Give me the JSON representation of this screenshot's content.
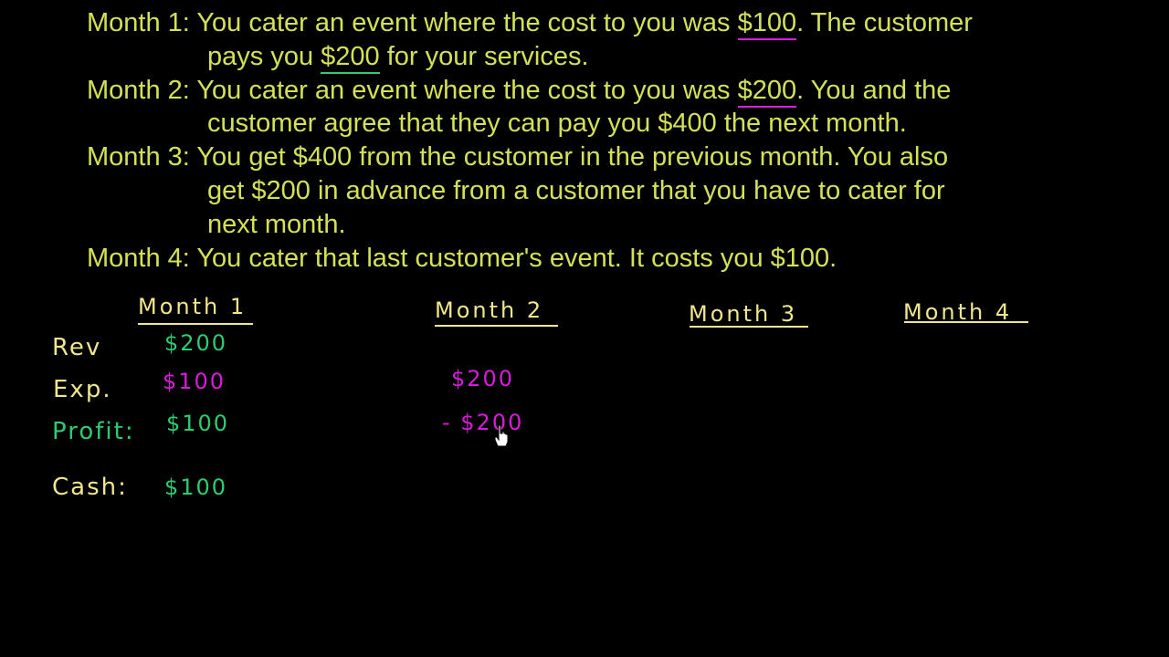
{
  "problem": {
    "month1": {
      "lead": "Month 1: You cater an event where the cost to you was ",
      "cost": "$100",
      "mid": ".  The customer",
      "line2_lead": "pays you ",
      "paid": "$200",
      "line2_tail": " for your services."
    },
    "month2": {
      "lead": "Month 2: You cater an event where the cost to you was ",
      "cost": "$200",
      "mid": ".  You and the",
      "line2": "customer agree that they can pay you $400 the next month."
    },
    "month3": {
      "line1": "Month 3: You get $400 from the customer in the previous month.  You also",
      "line2": "get $200 in advance from a customer that you have to cater for",
      "line3": "next month."
    },
    "month4": {
      "line1": "Month 4: You cater that last customer's event.  It costs you $100."
    }
  },
  "table": {
    "headers": [
      "Month 1",
      "Month 2",
      "Month 3",
      "Month 4"
    ],
    "row_labels": {
      "rev": "Rev",
      "exp": "Exp.",
      "profit": "Profit:",
      "cash": "Cash:"
    },
    "month1": {
      "rev": "$200",
      "exp": "$100",
      "profit": "$100",
      "cash": "$100"
    },
    "month2": {
      "exp": "$200",
      "profit": "- $200"
    }
  },
  "colors": {
    "problem_text": "#d4e157",
    "handwriting_yellow": "#f0e68c",
    "green": "#2ecc71",
    "magenta": "#d81bd8",
    "background": "#000000"
  },
  "icons": {
    "cursor": "hand-pointer-icon"
  }
}
